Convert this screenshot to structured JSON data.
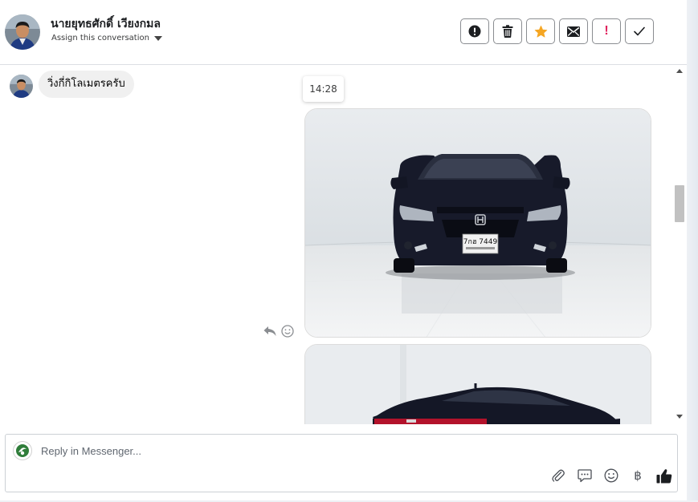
{
  "header": {
    "contact_name": "นายยุทธศักดิ์ เวียงกมล",
    "assign_label": "Assign this conversation",
    "toolbar": [
      {
        "name": "mark-spam-button",
        "icon": "alert-circle-icon"
      },
      {
        "name": "delete-button",
        "icon": "trash-icon"
      },
      {
        "name": "star-button",
        "icon": "star-icon"
      },
      {
        "name": "mark-unread-button",
        "icon": "envelope-icon"
      },
      {
        "name": "follow-up-button",
        "icon": "exclamation-icon",
        "text": "!"
      },
      {
        "name": "mark-done-button",
        "icon": "check-icon"
      }
    ]
  },
  "conversation": {
    "incoming_message": "วิ่งกี่กิโลเมตรครับ",
    "timestamp": "14:28",
    "photos": [
      {
        "subject": "car-front-photo",
        "plate_text": "7กฮ 7449"
      },
      {
        "subject": "car-rear-photo"
      }
    ],
    "message_actions": [
      "reply-icon",
      "emoji-reaction-icon"
    ]
  },
  "composer": {
    "placeholder": "Reply in Messenger...",
    "tools": [
      "attachment-icon",
      "saved-reply-icon",
      "emoji-icon",
      "payment-icon",
      "like-icon"
    ],
    "payment_symbol": "฿"
  },
  "colors": {
    "star": "#f5a623",
    "exclamation": "#e0245e",
    "border": "#8a8d91",
    "bubble": "#f0f0f0"
  }
}
